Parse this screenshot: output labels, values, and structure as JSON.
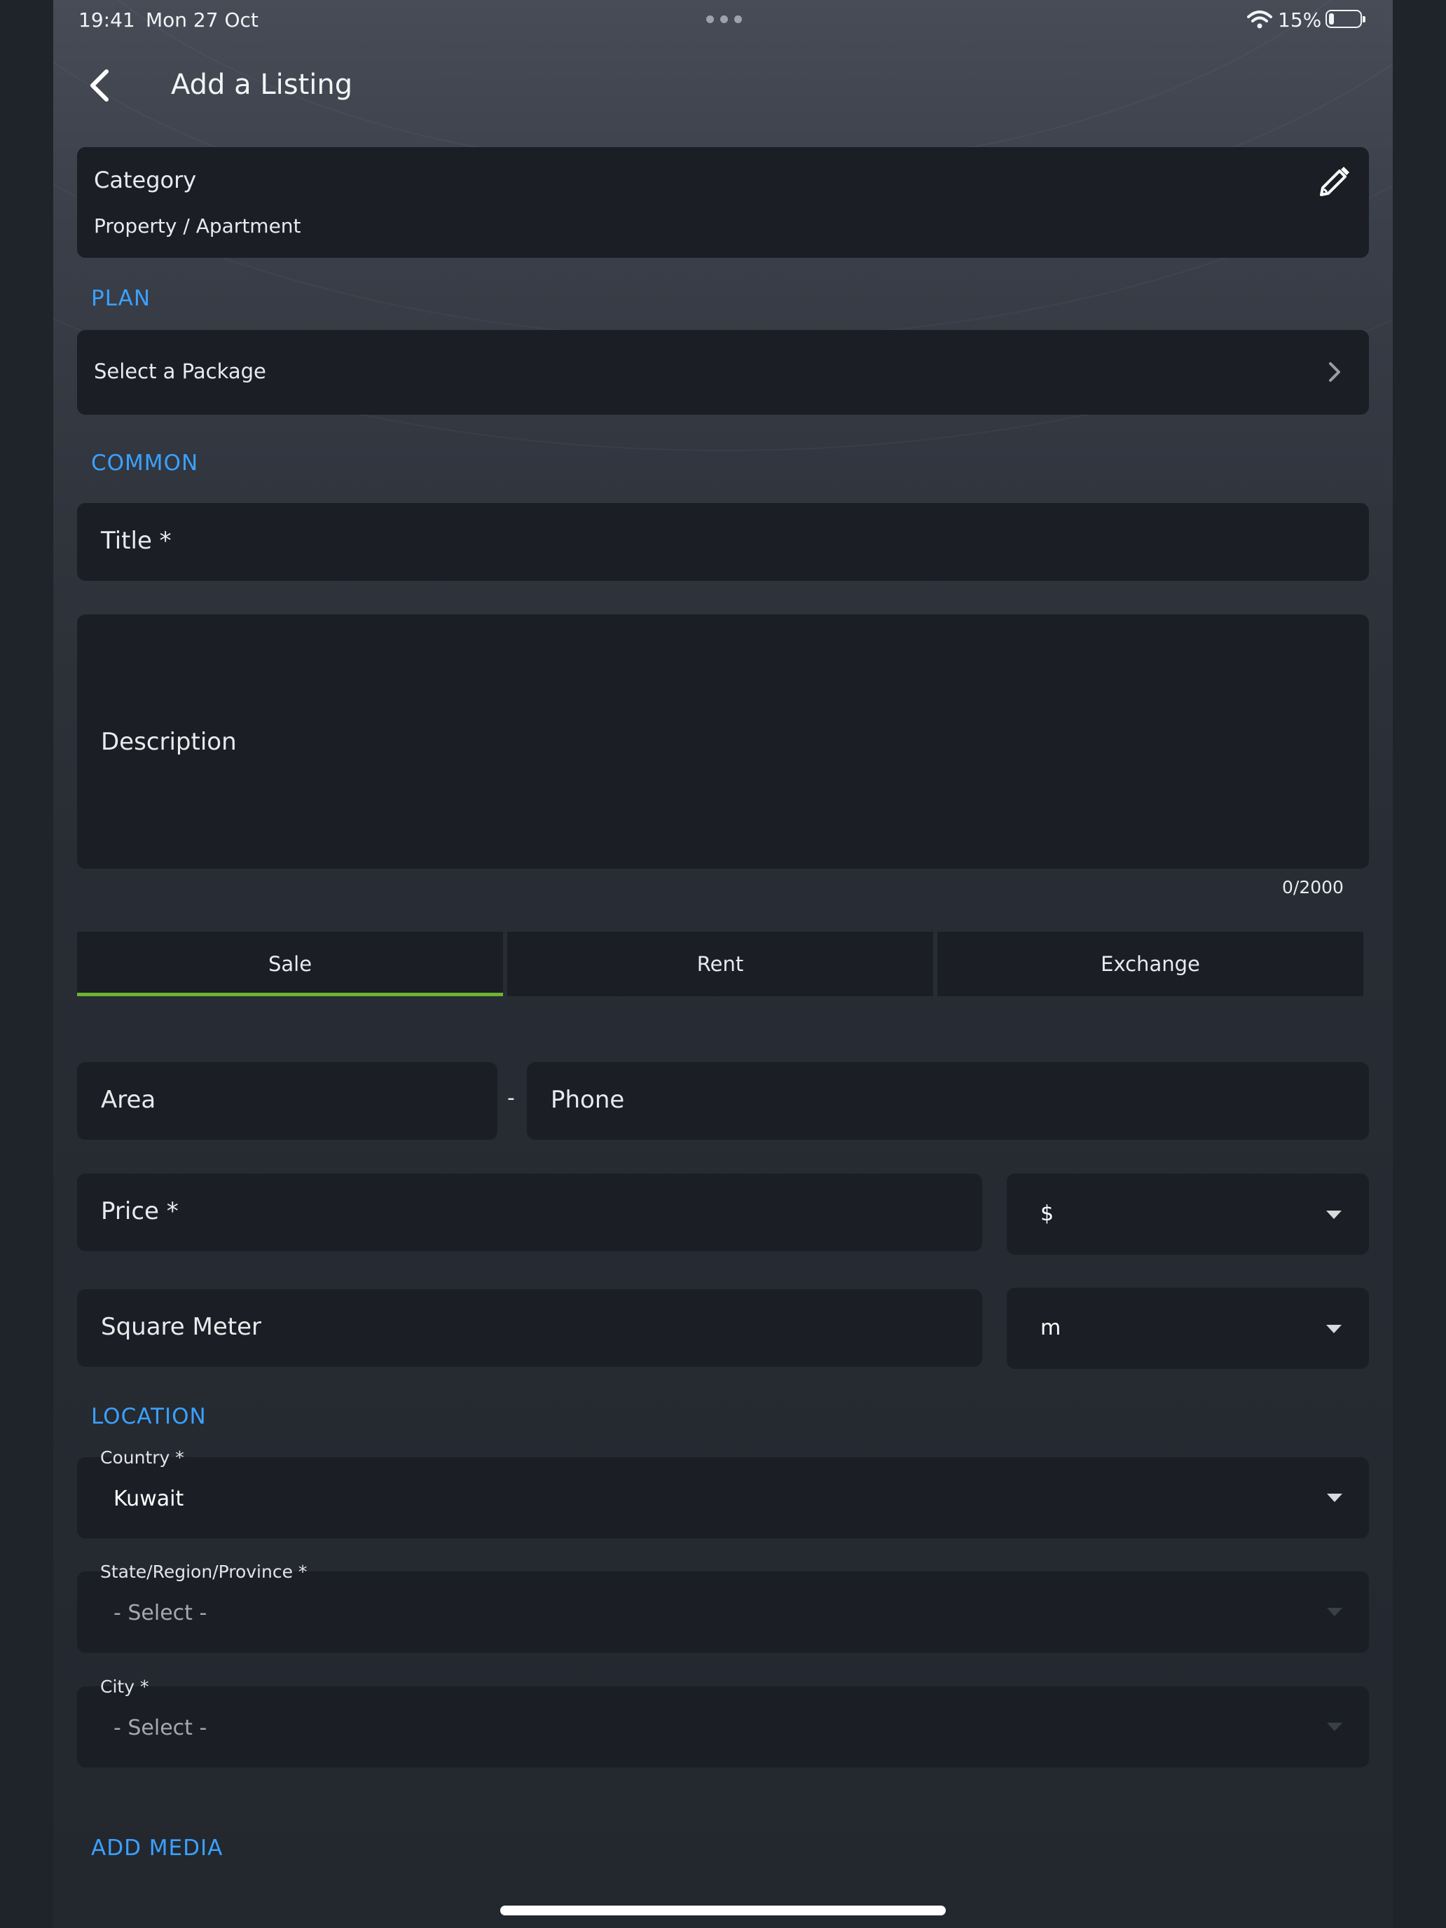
{
  "status": {
    "time": "19:41",
    "date": "Mon 27 Oct",
    "battery": "15%",
    "battery_level": 0.15
  },
  "header": {
    "title": "Add a Listing"
  },
  "category": {
    "label": "Category",
    "value": "Property / Apartment"
  },
  "sections": {
    "plan": "PLAN",
    "common": "COMMON",
    "location": "LOCATION",
    "media": "ADD MEDIA"
  },
  "plan": {
    "select_label": "Select a Package"
  },
  "common": {
    "title_placeholder": "Title *",
    "description_placeholder": "Description",
    "description_counter": "0/2000"
  },
  "tabs": [
    {
      "label": "Sale",
      "active": true
    },
    {
      "label": "Rent",
      "active": false
    },
    {
      "label": "Exchange",
      "active": false
    }
  ],
  "contact": {
    "area_placeholder": "Area",
    "separator": "-",
    "phone_placeholder": "Phone"
  },
  "price": {
    "placeholder": "Price *",
    "currency": "$"
  },
  "size": {
    "placeholder": "Square Meter",
    "unit": "m"
  },
  "location": {
    "country": {
      "label": "Country *",
      "value": "Kuwait"
    },
    "state": {
      "label": "State/Region/Province *",
      "placeholder": "- Select -"
    },
    "city": {
      "label": "City *",
      "placeholder": "- Select -"
    }
  },
  "colors": {
    "accent": "#3aa1ff",
    "tab_indicator": "#6eb332",
    "field_bg": "#1b1e25"
  },
  "icons": {
    "back": "chevron-left-icon",
    "edit": "pencil-icon",
    "plan": "chevron-right-icon",
    "dropdown": "caret-down-icon"
  }
}
